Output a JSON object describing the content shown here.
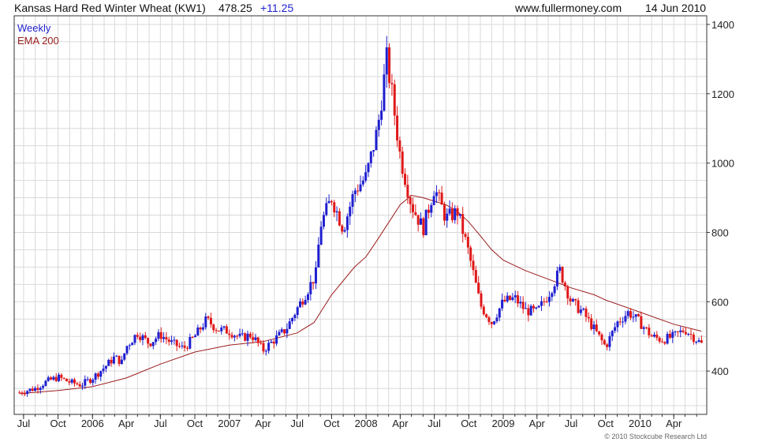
{
  "header": {
    "instrument": "Kansas Hard Red Winter Wheat (KW1)",
    "last_price": "478.25",
    "change": "+11.25",
    "website": "www.fullermoney.com",
    "date": "14 Jun 2010"
  },
  "footer": {
    "copyright": "© 2010 Stockcube Research Ltd"
  },
  "colors": {
    "up": "#1f1fd0",
    "down": "#e01818",
    "ema": "#9b1c1c",
    "grid": "#d9d9d9",
    "axis": "#333333"
  },
  "chart_data": {
    "type": "line",
    "title": "Kansas Hard Red Winter Wheat (KW1)",
    "xlabel": "",
    "ylabel": "",
    "ylim": [
      275,
      1425
    ],
    "y_ticks": [
      "400",
      "600",
      "800",
      "1000",
      "1200",
      "1400"
    ],
    "x_ticks": [
      "Jul",
      "Oct",
      "2006",
      "Apr",
      "Jul",
      "Oct",
      "2007",
      "Apr",
      "Jul",
      "Oct",
      "2008",
      "Apr",
      "Jul",
      "Oct",
      "2009",
      "Apr",
      "Jul",
      "Oct",
      "2010",
      "Apr"
    ],
    "x_tick_dates": [
      "2005-07-01",
      "2005-10-01",
      "2006-01-01",
      "2006-04-01",
      "2006-07-01",
      "2006-10-01",
      "2007-01-01",
      "2007-04-01",
      "2007-07-01",
      "2007-10-01",
      "2008-01-01",
      "2008-04-01",
      "2008-07-01",
      "2008-10-01",
      "2009-01-01",
      "2009-04-01",
      "2009-07-01",
      "2009-10-01",
      "2010-01-01",
      "2010-04-01"
    ],
    "grid": true,
    "legend_position": "top-left",
    "series": [
      {
        "name": "Weekly",
        "style": "candlestick",
        "points": [
          [
            "2005-06-20",
            338
          ],
          [
            "2005-07-04",
            342
          ],
          [
            "2005-08-01",
            350
          ],
          [
            "2005-09-01",
            370
          ],
          [
            "2005-10-01",
            382
          ],
          [
            "2005-11-01",
            368
          ],
          [
            "2005-12-01",
            360
          ],
          [
            "2006-01-01",
            380
          ],
          [
            "2006-02-01",
            410
          ],
          [
            "2006-03-01",
            440
          ],
          [
            "2006-03-20",
            425
          ],
          [
            "2006-04-01",
            470
          ],
          [
            "2006-05-01",
            510
          ],
          [
            "2006-06-01",
            480
          ],
          [
            "2006-07-01",
            505
          ],
          [
            "2006-08-01",
            480
          ],
          [
            "2006-09-01",
            465
          ],
          [
            "2006-10-01",
            500
          ],
          [
            "2006-11-01",
            548
          ],
          [
            "2006-12-01",
            520
          ],
          [
            "2007-01-01",
            515
          ],
          [
            "2007-02-01",
            495
          ],
          [
            "2007-03-01",
            505
          ],
          [
            "2007-04-01",
            460
          ],
          [
            "2007-05-01",
            490
          ],
          [
            "2007-06-01",
            520
          ],
          [
            "2007-07-01",
            580
          ],
          [
            "2007-08-01",
            640
          ],
          [
            "2007-08-20",
            680
          ],
          [
            "2007-09-01",
            820
          ],
          [
            "2007-10-01",
            900
          ],
          [
            "2007-11-01",
            810
          ],
          [
            "2007-12-01",
            920
          ],
          [
            "2008-01-01",
            960
          ],
          [
            "2008-02-01",
            1100
          ],
          [
            "2008-02-25",
            1300
          ],
          [
            "2008-03-10",
            1200
          ],
          [
            "2008-04-01",
            1020
          ],
          [
            "2008-05-01",
            880
          ],
          [
            "2008-06-01",
            810
          ],
          [
            "2008-07-01",
            930
          ],
          [
            "2008-08-01",
            840
          ],
          [
            "2008-09-01",
            860
          ],
          [
            "2008-10-01",
            740
          ],
          [
            "2008-11-01",
            590
          ],
          [
            "2008-12-01",
            540
          ],
          [
            "2009-01-01",
            600
          ],
          [
            "2009-02-01",
            610
          ],
          [
            "2009-03-01",
            575
          ],
          [
            "2009-04-01",
            570
          ],
          [
            "2009-05-01",
            620
          ],
          [
            "2009-06-01",
            690
          ],
          [
            "2009-07-01",
            600
          ],
          [
            "2009-08-01",
            570
          ],
          [
            "2009-09-01",
            520
          ],
          [
            "2009-10-01",
            470
          ],
          [
            "2009-11-01",
            540
          ],
          [
            "2009-12-01",
            570
          ],
          [
            "2010-01-01",
            540
          ],
          [
            "2010-02-01",
            500
          ],
          [
            "2010-03-01",
            490
          ],
          [
            "2010-04-01",
            500
          ],
          [
            "2010-05-01",
            520
          ],
          [
            "2010-06-14",
            478
          ]
        ]
      },
      {
        "name": "EMA 200",
        "style": "line",
        "points": [
          [
            "2005-06-20",
            335
          ],
          [
            "2005-10-01",
            344
          ],
          [
            "2006-01-01",
            355
          ],
          [
            "2006-04-01",
            380
          ],
          [
            "2006-07-01",
            420
          ],
          [
            "2006-10-01",
            455
          ],
          [
            "2007-01-01",
            475
          ],
          [
            "2007-04-01",
            485
          ],
          [
            "2007-07-01",
            510
          ],
          [
            "2007-08-15",
            540
          ],
          [
            "2007-10-01",
            620
          ],
          [
            "2007-12-01",
            700
          ],
          [
            "2008-01-01",
            730
          ],
          [
            "2008-02-01",
            780
          ],
          [
            "2008-04-01",
            880
          ],
          [
            "2008-05-01",
            907
          ],
          [
            "2008-06-01",
            900
          ],
          [
            "2008-07-01",
            890
          ],
          [
            "2008-08-01",
            880
          ],
          [
            "2008-09-01",
            860
          ],
          [
            "2008-10-01",
            830
          ],
          [
            "2008-11-01",
            790
          ],
          [
            "2008-12-01",
            750
          ],
          [
            "2009-01-01",
            720
          ],
          [
            "2009-03-01",
            690
          ],
          [
            "2009-05-01",
            665
          ],
          [
            "2009-07-01",
            640
          ],
          [
            "2009-09-01",
            620
          ],
          [
            "2009-10-01",
            605
          ],
          [
            "2010-01-01",
            570
          ],
          [
            "2010-04-01",
            535
          ],
          [
            "2010-06-14",
            515
          ]
        ]
      }
    ]
  }
}
